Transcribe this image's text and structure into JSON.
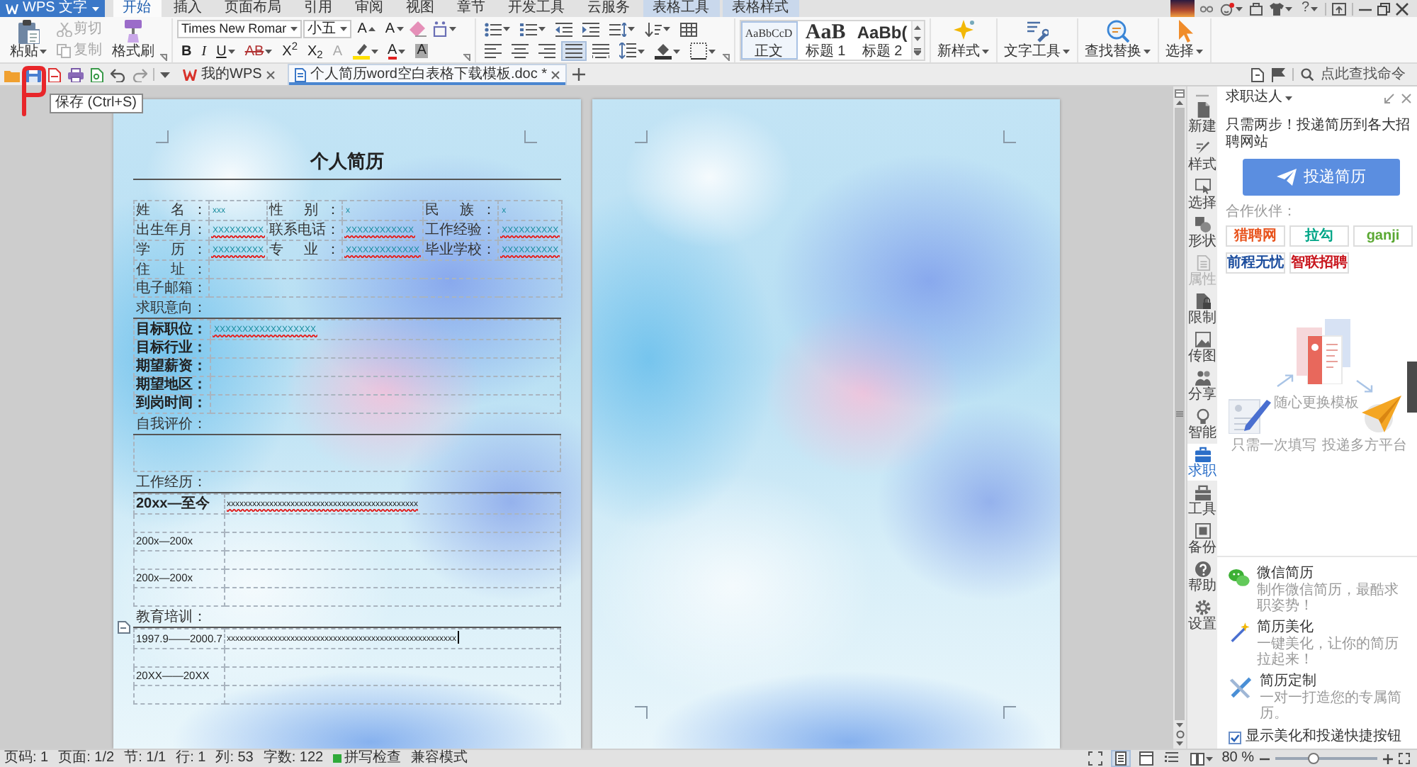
{
  "app_menu": {
    "label": "WPS 文字"
  },
  "menu_tabs": [
    {
      "label": "开始",
      "selected": true,
      "kind": "main"
    },
    {
      "label": "插入",
      "selected": false,
      "kind": "main"
    },
    {
      "label": "页面布局",
      "selected": false,
      "kind": "main"
    },
    {
      "label": "引用",
      "selected": false,
      "kind": "main"
    },
    {
      "label": "审阅",
      "selected": false,
      "kind": "main"
    },
    {
      "label": "视图",
      "selected": false,
      "kind": "main"
    },
    {
      "label": "章节",
      "selected": false,
      "kind": "main"
    },
    {
      "label": "开发工具",
      "selected": false,
      "kind": "main"
    },
    {
      "label": "云服务",
      "selected": false,
      "kind": "main"
    },
    {
      "label": "表格工具",
      "selected": false,
      "kind": "context"
    },
    {
      "label": "表格样式",
      "selected": false,
      "kind": "context"
    }
  ],
  "window_controls": {
    "help": "?"
  },
  "ribbon": {
    "paste": "粘贴",
    "cut": {
      "label": "剪切",
      "disabled": true
    },
    "copy": {
      "label": "复制",
      "disabled": true
    },
    "format_painter": "格式刷",
    "font_name": "Times New Romar",
    "font_size": "小五",
    "size_tools": [
      {
        "kind": "grow",
        "glyph": "A"
      },
      {
        "kind": "shrink",
        "glyph": "A"
      }
    ],
    "format_tools": [
      {
        "kind": "bold",
        "glyph": "B"
      },
      {
        "kind": "italic",
        "glyph": "I"
      },
      {
        "kind": "underline",
        "glyph": "U"
      },
      {
        "kind": "strike",
        "glyph": "AB"
      },
      {
        "kind": "superscript",
        "glyph": "X$^{2}$"
      },
      {
        "kind": "subscript",
        "glyph": "X$_{2}$"
      },
      {
        "kind": "effect",
        "glyph": "A"
      },
      {
        "kind": "highlight"
      },
      {
        "kind": "color",
        "glyph": "A"
      },
      {
        "kind": "shade",
        "glyph": "A"
      }
    ],
    "align_tools": [
      {
        "kind": "left",
        "selected": false
      },
      {
        "kind": "center",
        "selected": false
      },
      {
        "kind": "right",
        "selected": false
      },
      {
        "kind": "justify",
        "selected": true
      },
      {
        "kind": "distributed",
        "selected": false
      }
    ],
    "styles": [
      {
        "kind": "body",
        "preview": "AaBbCcD",
        "label": "正文",
        "selected": true
      },
      {
        "kind": "heading1",
        "preview": "AaB",
        "label": "标题 1",
        "selected": false
      },
      {
        "kind": "heading2",
        "preview": "AaBb(",
        "label": "标题 2",
        "selected": false
      }
    ],
    "big_buttons": [
      {
        "kind": "new-style",
        "label": "新样式"
      },
      {
        "kind": "text-tools",
        "label": "文字工具"
      },
      {
        "kind": "find",
        "label": "查找替换"
      },
      {
        "kind": "select",
        "label": "选择"
      }
    ]
  },
  "tooltip": "保存 (Ctrl+S)",
  "doc_tabs": [
    {
      "kind": "home",
      "label": "我的WPS",
      "selected": false
    },
    {
      "kind": "document",
      "label": "个人简历word空白表格下载模板.doc *",
      "selected": true
    }
  ],
  "command_search": {
    "placeholder": "点此查找命令"
  },
  "resume": {
    "title": "个人简历",
    "info_rows": [
      [
        {
          "label": "姓 名：",
          "value": "xxx",
          "spelling_error": false
        },
        {
          "label": "性 别：",
          "value": "x",
          "spelling_error": false
        },
        {
          "label": "民 族：",
          "value": "x",
          "spelling_error": false
        }
      ],
      [
        {
          "label": "出生年月：",
          "value": "XXXXXXXXX",
          "spelling_error": true
        },
        {
          "label": "联系电话：",
          "value": "XXXXXXXXXXXX",
          "spelling_error": true
        },
        {
          "label": "工作经验：",
          "value": "XXXXXXXXXX",
          "spelling_error": true
        }
      ],
      [
        {
          "label": "学 历：",
          "value": "XXXXXXXXX",
          "spelling_error": true
        },
        {
          "label": "专 业：",
          "value": "XXXXXXXXXXXXX",
          "spelling_error": true
        },
        {
          "label": "毕业学校：",
          "value": "XXXXXXXXXX",
          "spelling_error": true
        }
      ]
    ],
    "wide_rows": [
      {
        "label": "住 址："
      },
      {
        "label": "电子邮箱："
      }
    ],
    "sections": [
      {
        "kind": "fields",
        "heading": "求职意向：",
        "rows": [
          {
            "label": "目标职位：",
            "value": "XXXXXXXXXXXXXXXXXX",
            "spelling_error": true
          },
          {
            "label": "目标行业："
          },
          {
            "label": "期望薪资："
          },
          {
            "label": "期望地区："
          },
          {
            "label": "到岗时间："
          }
        ]
      },
      {
        "kind": "box",
        "heading": "自我评价："
      },
      {
        "kind": "entries",
        "heading": "工作经历：",
        "rows": [
          {
            "label": "20xx—至今",
            "bold": true,
            "value": "xxxxxxxxxxxxxxxxxxxxxxxxxxxxxxxxxxxxxxxxxxxxx",
            "spelling_error": true,
            "cursor": false
          },
          {
            "label": "200x—200x",
            "bold": false,
            "cursor": false
          },
          {
            "label": "200x—200x",
            "bold": false,
            "cursor": false
          }
        ]
      },
      {
        "kind": "entries",
        "heading": "教育培训：",
        "rows": [
          {
            "label": "1997.9——2000.7",
            "bold": false,
            "value": "xxxxxxxxxxxxxxxxxxxxxxxxxxxxxxxxxxxxxxxxxxxxxxxxxxxxxx",
            "spelling_error": false,
            "cursor": true
          },
          {
            "label": "20XX——20XX",
            "bold": false,
            "cursor": false
          }
        ]
      }
    ]
  },
  "task_pane": {
    "title": "求职达人",
    "strip": [
      {
        "label": "新建",
        "selected": false,
        "disabled": false
      },
      {
        "label": "样式",
        "selected": false,
        "disabled": false
      },
      {
        "label": "选择",
        "selected": false,
        "disabled": false
      },
      {
        "label": "形状",
        "selected": false,
        "disabled": false
      },
      {
        "label": "属性",
        "selected": false,
        "disabled": true
      },
      {
        "label": "限制",
        "selected": false,
        "disabled": false
      },
      {
        "label": "传图",
        "selected": false,
        "disabled": false
      },
      {
        "label": "分享",
        "selected": false,
        "disabled": false
      },
      {
        "label": "智能",
        "selected": false,
        "disabled": false
      },
      {
        "label": "求职",
        "selected": true,
        "disabled": false
      },
      {
        "label": "工具",
        "selected": false,
        "disabled": false
      },
      {
        "label": "备份",
        "selected": false,
        "disabled": false
      },
      {
        "label": "帮助",
        "selected": false,
        "disabled": false
      },
      {
        "label": "设置",
        "selected": false,
        "disabled": false
      }
    ],
    "intro": "只需两步！投递简历到各大招聘网站",
    "primary_button": "投递简历",
    "partners_label": "合作伙伴：",
    "partners": [
      {
        "name": "猎聘网",
        "color": "#e8541e"
      },
      {
        "name": "拉勾",
        "color": "#00a587"
      },
      {
        "name": "ganji",
        "color": "#5aa832"
      },
      {
        "name": "前程无忧",
        "color": "#1d4e9e"
      },
      {
        "name": "智联招聘",
        "color": "#c8161e"
      }
    ],
    "steps": [
      "只需一次填写",
      "随心更换模板",
      "投递多方平台"
    ],
    "features": [
      {
        "kind": "wechat",
        "title": "微信简历",
        "desc": "制作微信简历，最酷求职姿势！"
      },
      {
        "kind": "beautify",
        "title": "简历美化",
        "desc": "一键美化，让你的简历拉起来！"
      },
      {
        "kind": "custom",
        "title": "简历定制",
        "desc": "一对一打造您的专属简历。"
      }
    ],
    "show_shortcuts": {
      "label": "显示美化和投递快捷按钮",
      "checked": true
    }
  },
  "status_bar": {
    "fields": [
      "页码: 1",
      "页面: 1/2",
      "节: 1/1",
      "行: 1",
      "列: 53",
      "字数: 122"
    ],
    "spell_check": {
      "label": "拼写检查",
      "on": true
    },
    "mode": "兼容模式",
    "views": [
      {
        "kind": "fullscreen",
        "selected": false
      },
      {
        "kind": "page",
        "selected": true
      },
      {
        "kind": "web",
        "selected": false
      },
      {
        "kind": "outline",
        "selected": false
      },
      {
        "kind": "reading",
        "selected": false
      }
    ],
    "zoom": {
      "label": "80 %",
      "level": 0.37
    }
  }
}
